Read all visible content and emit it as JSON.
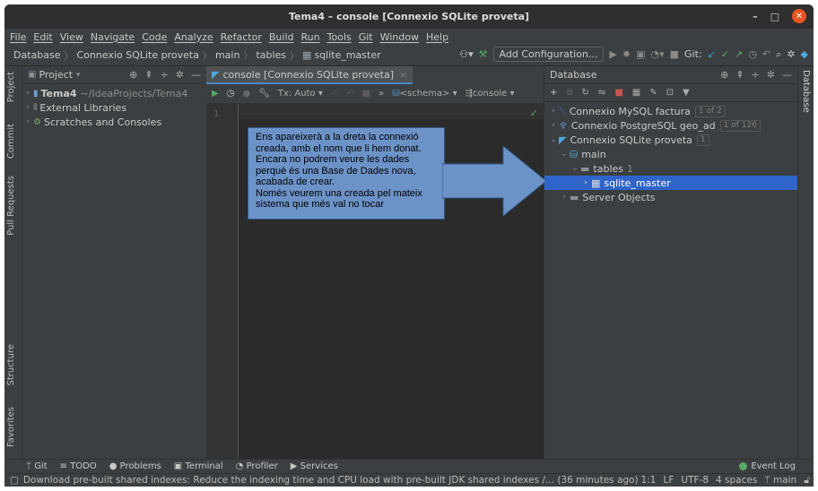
{
  "window": {
    "title": "Tema4 – console [Connexio SQLite proveta]"
  },
  "menu": [
    "File",
    "Edit",
    "View",
    "Navigate",
    "Code",
    "Analyze",
    "Refactor",
    "Build",
    "Run",
    "Tools",
    "Git",
    "Window",
    "Help"
  ],
  "breadcrumb": [
    "Database",
    "Connexio SQLite proveta",
    "main",
    "tables",
    "sqlite_master"
  ],
  "toolbar": {
    "add_config": "Add Configuration...",
    "git_label": "Git:"
  },
  "left_tabs": {
    "project": "Project",
    "commit": "Commit",
    "pull_requests": "Pull Requests",
    "structure": "Structure",
    "favorites": "Favorites"
  },
  "project": {
    "header": "Project",
    "tree": [
      {
        "name": "Tema4",
        "path": "~/IdeaProjects/Tema4"
      },
      {
        "name": "External Libraries"
      },
      {
        "name": "Scratches and Consoles"
      }
    ]
  },
  "editor": {
    "tab": "console [Connexio SQLite proveta]",
    "tx": "Tx: Auto",
    "schema": "<schema>",
    "console": "console",
    "line_number": "1"
  },
  "database": {
    "header": "Database",
    "tab_label": "Database",
    "rows": [
      {
        "name": "Connexio MySQL factura",
        "badge": "1 of 2"
      },
      {
        "name": "Connexio PostgreSQL geo_ad",
        "badge": "1 of 126"
      },
      {
        "name": "Connexio SQLite proveta",
        "badge": "1"
      },
      {
        "name": "main"
      },
      {
        "name": "tables",
        "count": "1"
      },
      {
        "name": "sqlite_master"
      },
      {
        "name": "Server Objects"
      }
    ]
  },
  "annotation": {
    "lines": [
      "Ens apareixerà a la dreta la connexió",
      "creada, amb el nom que li hem donat.",
      "Encara no podrem veure les dades",
      "perquè és una Base de Dades nova,",
      "acabada de crear.",
      "Només veurem una creada pel mateix",
      "sistema que més val no tocar"
    ]
  },
  "bottom_tabs": [
    "Git",
    "TODO",
    "Problems",
    "Terminal",
    "Profiler",
    "Services"
  ],
  "event_log": {
    "count": "1",
    "label": "Event Log"
  },
  "status": {
    "message": "Download pre-built shared indexes: Reduce the indexing time and CPU load with pre-built JDK shared indexes /... (36 minutes ago)",
    "position": "1:1",
    "line_sep": "LF",
    "encoding": "UTF-8",
    "indent": "4 spaces",
    "branch": "main"
  },
  "colors": {
    "accent": "#2f65ca",
    "callout": "#6c93c8",
    "close": "#e95420"
  }
}
